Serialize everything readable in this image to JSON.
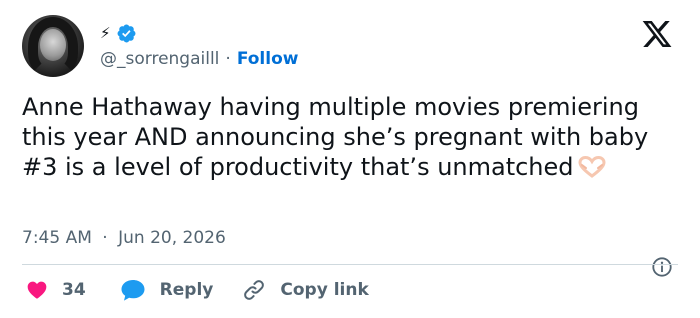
{
  "header": {
    "badge_glyph": "⚡",
    "handle": "@_sorrengailll",
    "separator": "·",
    "follow_label": "Follow"
  },
  "tweet": {
    "text": "Anne Hathaway having multiple movies premiering this year AND announcing she’s pregnant with baby #3 is a level of productivity that’s unmatched",
    "emoji": "heart-hands-emoji"
  },
  "meta": {
    "time": "7:45 AM",
    "separator": "·",
    "date": "Jun 20, 2026"
  },
  "actions": {
    "like_count": "34",
    "reply_label": "Reply",
    "copy_label": "Copy link"
  },
  "colors": {
    "accent": "#006fd6",
    "verified": "#1d9bf0",
    "like": "#f91880",
    "text": "#0f1419",
    "muted": "#536471",
    "divider": "#cfd9de"
  },
  "icons": [
    "verified-badge-icon",
    "x-logo-icon",
    "info-icon",
    "heart-icon",
    "reply-bubble-icon",
    "link-icon"
  ]
}
